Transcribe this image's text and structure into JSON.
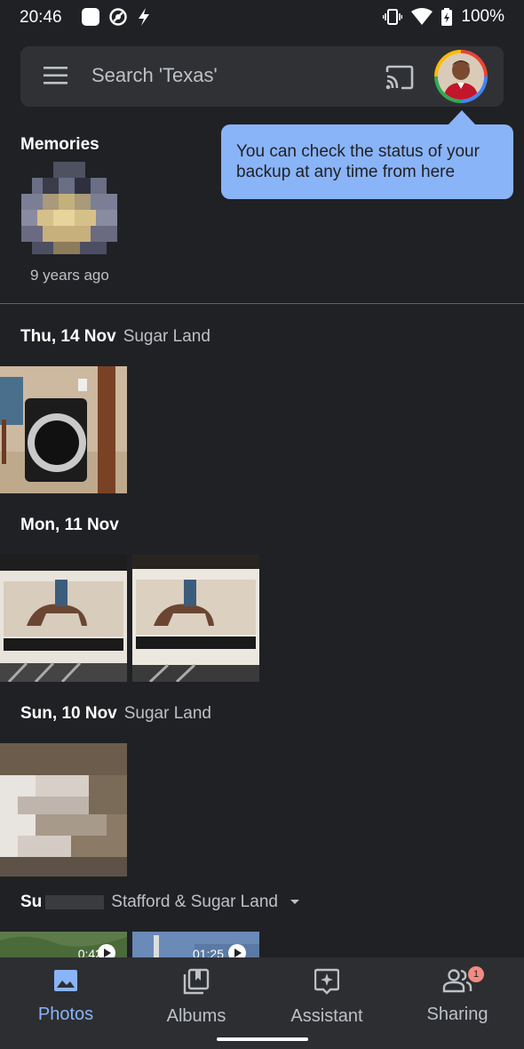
{
  "status_bar": {
    "time": "20:46",
    "battery": "100%"
  },
  "search": {
    "placeholder": "Search 'Texas'"
  },
  "tooltip": {
    "text": "You can check the status of your backup at any time from here"
  },
  "memories": {
    "title": "Memories",
    "items": [
      {
        "caption": "9 years ago"
      }
    ]
  },
  "sections": [
    {
      "date": "Thu, 14 Nov",
      "location": "Sugar Land"
    },
    {
      "date": "Mon, 11 Nov",
      "location": ""
    },
    {
      "date": "Sun, 10 Nov",
      "location": "Sugar Land"
    },
    {
      "date": "Su",
      "location": "Stafford & Sugar Land"
    }
  ],
  "videos": [
    {
      "duration": "0:42"
    },
    {
      "duration": "01:25"
    }
  ],
  "bottom_nav": {
    "items": [
      {
        "label": "Photos",
        "icon": "photo-icon",
        "active": true
      },
      {
        "label": "Albums",
        "icon": "albums-icon"
      },
      {
        "label": "Assistant",
        "icon": "assistant-icon"
      },
      {
        "label": "Sharing",
        "icon": "sharing-icon",
        "badge": "1"
      }
    ]
  },
  "colors": {
    "background": "#202124",
    "accent": "#8ab4f8",
    "search_bg": "#303134",
    "nav_bg": "#2d2e31"
  }
}
